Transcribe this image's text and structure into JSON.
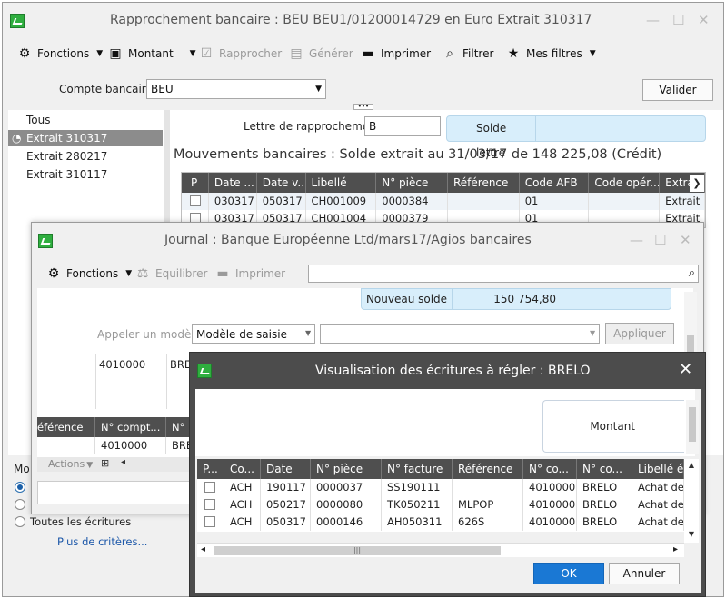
{
  "main": {
    "title": "Rapprochement bancaire : BEU BEU1/01200014729 en Euro Extrait 310317",
    "toolbar": {
      "fonctions": "Fonctions",
      "montant": "Montant",
      "rapprocher": "Rapprocher",
      "generer": "Générer",
      "imprimer": "Imprimer",
      "filtrer": "Filtrer",
      "mes_filtres": "Mes filtres"
    },
    "compte_label": "Compte bancaire",
    "compte_value": "BEU",
    "valider": "Valider",
    "tree": [
      "Tous",
      "Extrait 310317",
      "Extrait 280217",
      "Extrait 310117"
    ],
    "lettre_label": "Lettre de rapprochement",
    "lettre_value": "B",
    "solde_lettre": "Solde lettre",
    "mouvements_title": "Mouvements bancaires : Solde extrait au 31/03/17 de 148 225,08 (Crédit)",
    "headers": [
      "P",
      "Date ...",
      "Date v...",
      "Libellé",
      "N° pièce",
      "Référence",
      "Code AFB",
      "Code opér...",
      "Extra"
    ],
    "rows": [
      [
        "030317",
        "050317",
        "CH001009",
        "0000384",
        "",
        "01",
        "",
        "Extrait"
      ],
      [
        "030317",
        "050317",
        "CH001004",
        "0000379",
        "",
        "01",
        "",
        "Extrait"
      ]
    ],
    "side": {
      "mo": "Mo",
      "toutes": "Toutes les écritures",
      "plus": "Plus de critères..."
    }
  },
  "journal": {
    "title": "Journal : Banque Européenne Ltd/mars17/Agios bancaires",
    "fonctions": "Fonctions",
    "equilibrer": "Equilibrer",
    "imprimer": "Imprimer",
    "nouveau_solde": "Nouveau solde",
    "nouveau_solde_value": "150 754,80",
    "appeler": "Appeler un modèle",
    "modele": "Modèle de saisie",
    "appliquer": "Appliquer",
    "row1_compte": "4010000",
    "row1_lib": "BRE",
    "headers": [
      "éférence",
      "N° compt...",
      "N°"
    ],
    "row2_compte": "4010000",
    "row2_lib": "BRE",
    "actions": "Actions"
  },
  "visu": {
    "title": "Visualisation des écritures à régler : BRELO",
    "montant": "Montant",
    "headers": [
      "P...",
      "Co...",
      "Date",
      "N° pièce",
      "N° facture",
      "Référence",
      "N° co...",
      "N° co...",
      "Libellé éc"
    ],
    "rows": [
      [
        "ACH",
        "190117",
        "0000037",
        "SS190111",
        "",
        "4010000",
        "BRELO",
        "Achat de r"
      ],
      [
        "ACH",
        "050217",
        "0000080",
        "TK050211",
        "MLPOP",
        "4010000",
        "BRELO",
        "Achat de r"
      ],
      [
        "ACH",
        "050317",
        "0000146",
        "AH050311",
        "626S",
        "4010000",
        "BRELO",
        "Achat de r"
      ]
    ],
    "ok": "OK",
    "annuler": "Annuler"
  }
}
